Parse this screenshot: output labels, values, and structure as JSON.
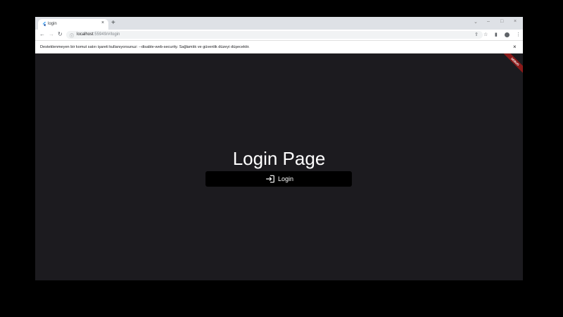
{
  "browser": {
    "tab": {
      "title": "login",
      "close_glyph": "×"
    },
    "new_tab_glyph": "+",
    "window_controls": {
      "chevron": "⌄",
      "minimize": "–",
      "maximize": "□",
      "close": "×"
    },
    "nav": {
      "back": "←",
      "forward": "→",
      "reload": "↻"
    },
    "address": {
      "info_glyph": "ⓘ",
      "host": "localhost",
      "path": ":55949/#/login"
    },
    "toolbar_icons": {
      "share": "⇪",
      "star": "☆",
      "sidepanel": "▮",
      "menu": "⋮"
    }
  },
  "infobar": {
    "message": "Desteklenmeyen bir komut satırı işareti kullanıyorsunuz: --disable-web-security. Sağlamlık ve güvenlik düzeyi düşecektir.",
    "close_glyph": "×"
  },
  "app": {
    "debug_banner": "DEBUG",
    "title": "Login Page",
    "login_button": {
      "label": "Login",
      "icon": "login-icon"
    }
  },
  "colors": {
    "background": "#1c1b1f",
    "button": "#000000",
    "text": "#ffffff",
    "debug": "#8b1a1a"
  }
}
